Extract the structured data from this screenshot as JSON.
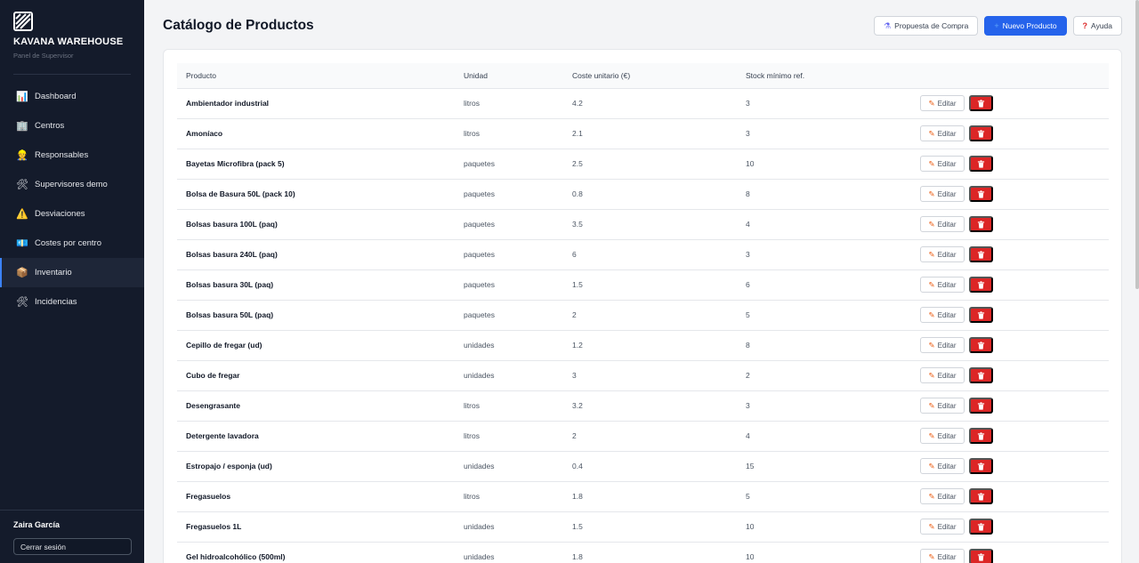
{
  "sidebar": {
    "brand_title": "KAVANA WAREHOUSE",
    "brand_subtitle": "Panel de Supervisor",
    "items": [
      {
        "label": "Dashboard",
        "icon": "📊",
        "icon_name": "bar-chart-icon"
      },
      {
        "label": "Centros",
        "icon": "🏢",
        "icon_name": "building-icon"
      },
      {
        "label": "Responsables",
        "icon": "👷",
        "icon_name": "worker-icon"
      },
      {
        "label": "Supervisores demo",
        "icon": "🛠",
        "icon_name": "tools-icon"
      },
      {
        "label": "Desviaciones",
        "icon": "⚠️",
        "icon_name": "warning-icon"
      },
      {
        "label": "Costes por centro",
        "icon": "💶",
        "icon_name": "money-icon"
      },
      {
        "label": "Inventario",
        "icon": "📦",
        "icon_name": "package-icon",
        "active": true
      },
      {
        "label": "Incidencias",
        "icon": "🛠",
        "icon_name": "tools-icon"
      }
    ],
    "user_name": "Zaira García",
    "logout_label": "Cerrar sesión"
  },
  "header": {
    "title": "Catálogo de Productos",
    "purchase_label": "Propuesta de Compra",
    "new_product_label": "Nuevo Producto",
    "help_label": "Ayuda"
  },
  "table": {
    "columns": [
      "Producto",
      "Unidad",
      "Coste unitario (€)",
      "Stock mínimo ref.",
      ""
    ],
    "edit_label": "Editar",
    "rows": [
      {
        "product": "Ambientador industrial",
        "unit": "litros",
        "cost": "4.2",
        "stock": "3"
      },
      {
        "product": "Amoníaco",
        "unit": "litros",
        "cost": "2.1",
        "stock": "3"
      },
      {
        "product": "Bayetas Microfibra (pack 5)",
        "unit": "paquetes",
        "cost": "2.5",
        "stock": "10"
      },
      {
        "product": "Bolsa de Basura 50L (pack 10)",
        "unit": "paquetes",
        "cost": "0.8",
        "stock": "8"
      },
      {
        "product": "Bolsas basura 100L (paq)",
        "unit": "paquetes",
        "cost": "3.5",
        "stock": "4"
      },
      {
        "product": "Bolsas basura 240L (paq)",
        "unit": "paquetes",
        "cost": "6",
        "stock": "3"
      },
      {
        "product": "Bolsas basura 30L (paq)",
        "unit": "paquetes",
        "cost": "1.5",
        "stock": "6"
      },
      {
        "product": "Bolsas basura 50L (paq)",
        "unit": "paquetes",
        "cost": "2",
        "stock": "5"
      },
      {
        "product": "Cepillo de fregar (ud)",
        "unit": "unidades",
        "cost": "1.2",
        "stock": "8"
      },
      {
        "product": "Cubo de fregar",
        "unit": "unidades",
        "cost": "3",
        "stock": "2"
      },
      {
        "product": "Desengrasante",
        "unit": "litros",
        "cost": "3.2",
        "stock": "3"
      },
      {
        "product": "Detergente lavadora",
        "unit": "litros",
        "cost": "2",
        "stock": "4"
      },
      {
        "product": "Estropajo / esponja (ud)",
        "unit": "unidades",
        "cost": "0.4",
        "stock": "15"
      },
      {
        "product": "Fregasuelos",
        "unit": "litros",
        "cost": "1.8",
        "stock": "5"
      },
      {
        "product": "Fregasuelos 1L",
        "unit": "unidades",
        "cost": "1.5",
        "stock": "10"
      },
      {
        "product": "Gel hidroalcohólico (500ml)",
        "unit": "unidades",
        "cost": "1.8",
        "stock": "10"
      }
    ]
  },
  "colors": {
    "sidebar_bg": "#141b2b",
    "primary": "#2563eb",
    "danger": "#dc2626",
    "edit_icon": "#ea580c"
  }
}
